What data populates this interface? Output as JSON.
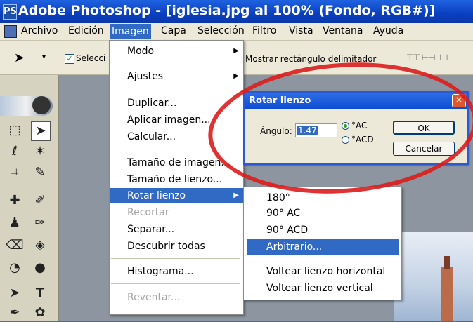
{
  "window": {
    "title": "Adobe Photoshop - [iglesia.jpg al 100% (Fondo, RGB#)]",
    "app_icon": "PS"
  },
  "menubar": {
    "items": [
      "Archivo",
      "Edición",
      "Imagen",
      "Capa",
      "Selección",
      "Filtro",
      "Vista",
      "Ventana",
      "Ayuda"
    ]
  },
  "options_bar": {
    "checkbox_label": "Selecci",
    "show_bounds_label": "Mostrar rectángulo delimitador"
  },
  "imagen_menu": {
    "items": [
      "Modo",
      "Ajustes",
      "Duplicar...",
      "Aplicar imagen...",
      "Calcular...",
      "Tamaño de imagen...",
      "Tamaño de lienzo...",
      "Rotar lienzo",
      "Recortar",
      "Separar...",
      "Descubrir todas",
      "Histograma...",
      "Reventar..."
    ]
  },
  "rotate_submenu": {
    "items": [
      "180°",
      "90° AC",
      "90° ACD",
      "Arbitrario...",
      "Voltear lienzo horizontal",
      "Voltear lienzo vertical"
    ]
  },
  "dialog": {
    "title": "Rotar lienzo",
    "angle_label": "Ángulo:",
    "angle_value": "1.47",
    "radio_ac": "°AC",
    "radio_acd": "°ACD",
    "ok_label": "OK",
    "cancel_label": "Cancelar",
    "selected_direction": "°AC"
  },
  "colors": {
    "highlight": "#316ac5",
    "annotation_ellipse": "#dd1c1c",
    "titlebar": "#0a3fc0"
  },
  "icons": [
    "move-tool-icon",
    "marquee-tool-icon",
    "lasso-tool-icon",
    "magic-wand-icon",
    "crop-tool-icon",
    "slice-tool-icon",
    "healing-brush-icon",
    "brush-tool-icon",
    "stamp-tool-icon",
    "history-brush-icon",
    "eraser-tool-icon",
    "paint-bucket-icon",
    "blur-tool-icon",
    "dodge-tool-icon",
    "path-select-icon",
    "type-tool-icon",
    "pen-tool-icon",
    "shape-tool-icon",
    "close-icon",
    "submenu-arrow-icon"
  ]
}
